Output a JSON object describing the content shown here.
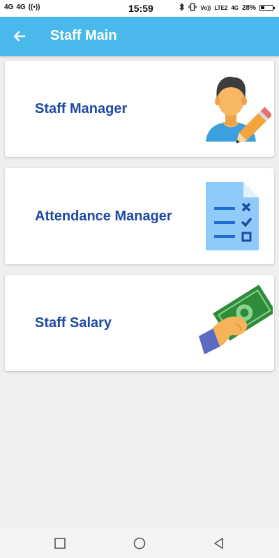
{
  "status_bar": {
    "left_indicators": [
      "4G",
      "4G",
      "((•))"
    ],
    "time": "15:59",
    "right_indicators": [
      "Vo))",
      "LTE2",
      "4G"
    ],
    "battery": "28%"
  },
  "app_bar": {
    "title": "Staff Main",
    "back_icon": "arrow-left-icon"
  },
  "cards": [
    {
      "label": "Staff Manager",
      "icon": "staff-edit-icon"
    },
    {
      "label": "Attendance Manager",
      "icon": "attendance-checklist-icon"
    },
    {
      "label": "Staff Salary",
      "icon": "salary-money-icon"
    }
  ],
  "nav_bar": {
    "buttons": [
      "recent-apps-icon",
      "home-icon",
      "back-icon"
    ]
  },
  "colors": {
    "app_bar": "#48b9ea",
    "card_label": "#1e4aa0",
    "background": "#efefef"
  }
}
